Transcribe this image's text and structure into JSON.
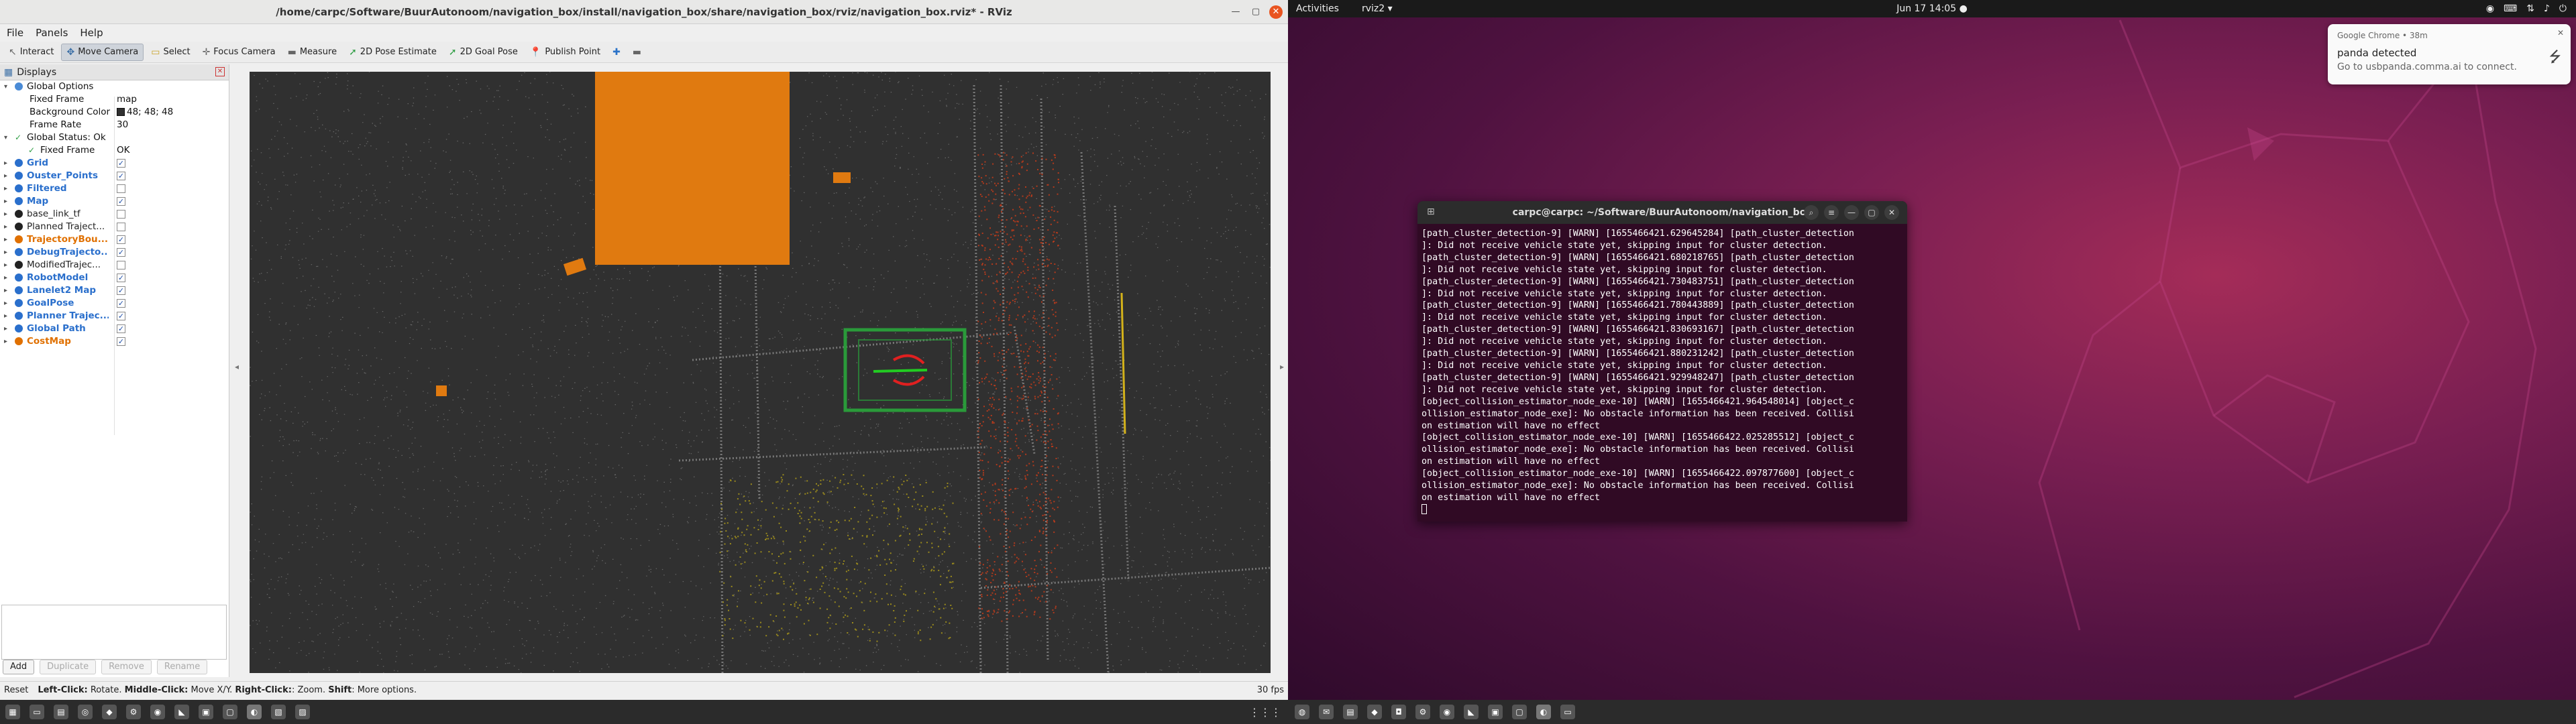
{
  "rviz": {
    "window_title": "/home/carpc/Software/BuurAutonoom/navigation_box/install/navigation_box/share/navigation_box/rviz/navigation_box.rviz* - RViz",
    "menu": [
      "File",
      "Panels",
      "Help"
    ],
    "tools": [
      {
        "label": "Interact",
        "icon": "interact-icon"
      },
      {
        "label": "Move Camera",
        "icon": "camera-icon",
        "active": true
      },
      {
        "label": "Select",
        "icon": "select-icon"
      },
      {
        "label": "Focus Camera",
        "icon": "focus-icon"
      },
      {
        "label": "Measure",
        "icon": "ruler-icon"
      },
      {
        "label": "2D Pose Estimate",
        "icon": "green-arrow-icon"
      },
      {
        "label": "2D Goal Pose",
        "icon": "green-arrow-icon"
      },
      {
        "label": "Publish Point",
        "icon": "pin-icon"
      },
      {
        "label": "+",
        "icon": "plus-icon"
      },
      {
        "label": "−",
        "icon": "minus-icon"
      }
    ],
    "displays_panel": {
      "title": "Displays",
      "global_options": "Global Options",
      "fixed_frame_label": "Fixed Frame",
      "fixed_frame_value": "map",
      "background_color_label": "Background Color",
      "background_color_value": "48; 48; 48",
      "frame_rate_label": "Frame Rate",
      "frame_rate_value": "30",
      "global_status": "Global Status: Ok",
      "status_fixed_frame_label": "Fixed Frame",
      "status_fixed_frame_value": "OK",
      "items": [
        {
          "name": "Grid",
          "checked": true,
          "color": "#2a6fcc"
        },
        {
          "name": "Ouster_Points",
          "checked": true,
          "color": "#2a6fcc"
        },
        {
          "name": "Filtered",
          "checked": false,
          "color": "#2a6fcc"
        },
        {
          "name": "Map",
          "checked": true,
          "color": "#2a6fcc"
        },
        {
          "name": "base_link_tf",
          "checked": false,
          "color": "#222222"
        },
        {
          "name": "Planned Traject...",
          "checked": false,
          "color": "#222222"
        },
        {
          "name": "TrajectoryBou...",
          "checked": true,
          "color": "#e07000"
        },
        {
          "name": "DebugTrajecto...",
          "checked": true,
          "color": "#2a6fcc"
        },
        {
          "name": "ModifiedTrajec...",
          "checked": false,
          "color": "#222222"
        },
        {
          "name": "RobotModel",
          "checked": true,
          "color": "#2a6fcc"
        },
        {
          "name": "Lanelet2 Map",
          "checked": true,
          "color": "#2a6fcc"
        },
        {
          "name": "GoalPose",
          "checked": true,
          "color": "#2a6fcc"
        },
        {
          "name": "Planner Trajec...",
          "checked": true,
          "color": "#2a6fcc"
        },
        {
          "name": "Global Path",
          "checked": true,
          "color": "#2a6fcc"
        },
        {
          "name": "CostMap",
          "checked": true,
          "color": "#e07000"
        }
      ],
      "buttons": {
        "add": "Add",
        "duplicate": "Duplicate",
        "remove": "Remove",
        "rename": "Rename"
      }
    },
    "status": {
      "reset": "Reset",
      "hint_left_key": "Left-Click:",
      "hint_left": " Rotate. ",
      "hint_middle_key": "Middle-Click:",
      "hint_middle": " Move X/Y. ",
      "hint_right_key": "Right-Click:",
      "hint_right": ": Zoom. ",
      "hint_shift_key": "Shift",
      "hint_shift": ": More options.",
      "fps": "30 fps"
    }
  },
  "desktop": {
    "activities": "Activities",
    "app_menu": "rviz2 ▾",
    "clock": "Jun 17  14:05  ●",
    "notification": {
      "app": "Google Chrome • 38m",
      "title": "panda detected",
      "body": "Go to usbpanda.comma.ai to connect."
    },
    "terminal": {
      "title": "carpc@carpc: ~/Software/BuurAutonoom/navigation_box",
      "lines": [
        "[path_cluster_detection-9] [WARN] [1655466421.629645284] [path_cluster_detection",
        "]: Did not receive vehicle state yet, skipping input for cluster detection.",
        "[path_cluster_detection-9] [WARN] [1655466421.680218765] [path_cluster_detection",
        "]: Did not receive vehicle state yet, skipping input for cluster detection.",
        "[path_cluster_detection-9] [WARN] [1655466421.730483751] [path_cluster_detection",
        "]: Did not receive vehicle state yet, skipping input for cluster detection.",
        "[path_cluster_detection-9] [WARN] [1655466421.780443889] [path_cluster_detection",
        "]: Did not receive vehicle state yet, skipping input for cluster detection.",
        "[path_cluster_detection-9] [WARN] [1655466421.830693167] [path_cluster_detection",
        "]: Did not receive vehicle state yet, skipping input for cluster detection.",
        "[path_cluster_detection-9] [WARN] [1655466421.880231242] [path_cluster_detection",
        "]: Did not receive vehicle state yet, skipping input for cluster detection.",
        "[path_cluster_detection-9] [WARN] [1655466421.929948247] [path_cluster_detection",
        "]: Did not receive vehicle state yet, skipping input for cluster detection.",
        "[object_collision_estimator_node_exe-10] [WARN] [1655466421.964548014] [object_c",
        "ollision_estimator_node_exe]: No obstacle information has been received. Collisi",
        "on estimation will have no effect",
        "[object_collision_estimator_node_exe-10] [WARN] [1655466422.025285512] [object_c",
        "ollision_estimator_node_exe]: No obstacle information has been received. Collisi",
        "on estimation will have no effect",
        "[object_collision_estimator_node_exe-10] [WARN] [1655466422.097877600] [object_c",
        "ollision_estimator_node_exe]: No obstacle information has been received. Collisi",
        "on estimation will have no effect"
      ]
    }
  }
}
